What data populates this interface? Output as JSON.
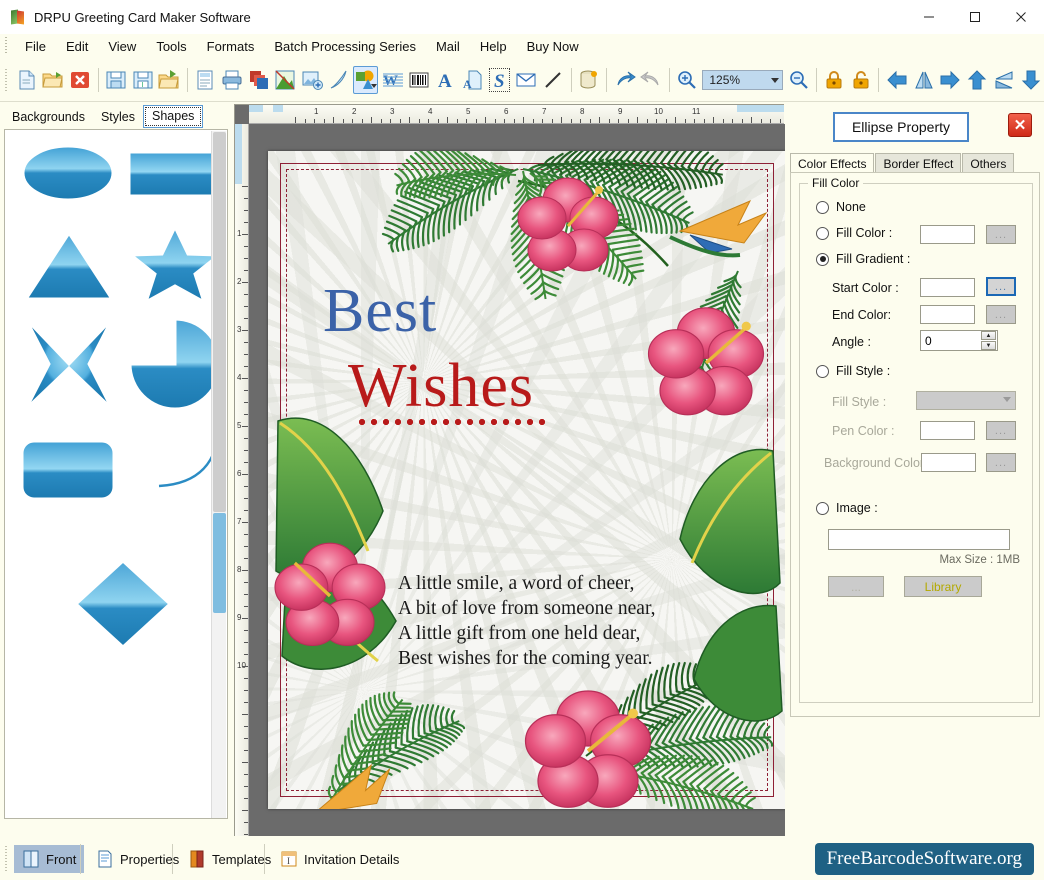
{
  "window": {
    "title": "DRPU Greeting Card Maker Software",
    "minimize": "–",
    "maximize": "☐",
    "close": "✕"
  },
  "menu": {
    "items": [
      {
        "label": "File"
      },
      {
        "label": "Edit"
      },
      {
        "label": "View"
      },
      {
        "label": "Tools"
      },
      {
        "label": "Formats"
      },
      {
        "label": "Batch Processing Series"
      },
      {
        "label": "Mail"
      },
      {
        "label": "Help"
      },
      {
        "label": "Buy Now"
      }
    ]
  },
  "toolbar": {
    "zoom_value": "125%",
    "icons": [
      "new-document-icon",
      "open-folder-icon",
      "close-document-icon",
      "save-icon",
      "save-as-icon",
      "export-folder-icon",
      "page-setup-icon",
      "print-icon",
      "copy-layers-icon",
      "clipart-icon",
      "insert-image-icon",
      "pen-tool-icon",
      "shapes-tool-icon",
      "watermark-icon",
      "barcode-icon",
      "text-icon",
      "text-on-page-icon",
      "signature-icon",
      "envelope-icon",
      "line-tool-icon",
      "database-icon",
      "undo-icon",
      "redo-icon",
      "zoom-in-icon",
      "zoom-out-icon",
      "lock-icon",
      "unlock-icon",
      "align-left-icon",
      "flip-horizontal-icon",
      "align-right-icon",
      "align-top-icon",
      "flip-vertical-icon",
      "align-bottom-icon"
    ]
  },
  "left_panel": {
    "tabs": [
      {
        "label": "Backgrounds",
        "active": false
      },
      {
        "label": "Styles",
        "active": false
      },
      {
        "label": "Shapes",
        "active": true
      }
    ],
    "shapes": [
      "ellipse-shape",
      "rectangle-shape",
      "triangle-shape",
      "star-shape",
      "four-point-star-shape",
      "pie-shape",
      "rounded-rectangle-shape",
      "arc-shape",
      "diamond-shape"
    ]
  },
  "canvas": {
    "ruler_h_labels": [
      "1",
      "2",
      "3",
      "4",
      "5",
      "6",
      "7",
      "8",
      "9",
      "10",
      "11"
    ],
    "ruler_v_labels": [
      "1",
      "2",
      "3",
      "4",
      "5",
      "6",
      "7",
      "8",
      "9",
      "10"
    ],
    "card": {
      "title_line1": "Best",
      "title_line2": "Wishes",
      "verse": "A little smile, a word of cheer,\nA bit of love from someone near,\nA little gift from one held dear,\nBest wishes for the coming year."
    }
  },
  "properties": {
    "title": "Ellipse Property",
    "close_label": "✕",
    "tabs": [
      {
        "label": "Color Effects",
        "active": true
      },
      {
        "label": "Border Effect",
        "active": false
      },
      {
        "label": "Others",
        "active": false
      }
    ],
    "group_label": "Fill Color",
    "options": {
      "none": "None",
      "fill_color": "Fill Color :",
      "fill_gradient": "Fill Gradient :",
      "fill_style": "Fill Style :",
      "image": "Image :"
    },
    "selected_option": "fill_gradient",
    "fields": {
      "start_color_label": "Start Color :",
      "end_color_label": "End Color:",
      "angle_label": "Angle :",
      "angle_value": "0",
      "fill_style_label": "Fill Style :",
      "pen_color_label": "Pen Color :",
      "background_color_label": "Background Color :",
      "browse_label": "...",
      "image_path": "",
      "max_size": "Max Size : 1MB",
      "image_browse_label": "...",
      "library_label": "Library"
    }
  },
  "bottom_bar": {
    "items": [
      {
        "label": "Front",
        "icon": "front-card-icon",
        "active": true
      },
      {
        "label": "Properties",
        "icon": "properties-icon",
        "active": false
      },
      {
        "label": "Templates",
        "icon": "templates-icon",
        "active": false
      },
      {
        "label": "Invitation Details",
        "icon": "invitation-details-icon",
        "active": false
      }
    ],
    "brand": "FreeBarcodeSoftware.org"
  },
  "colors": {
    "accent_blue": "#1b68b5",
    "panel_bg": "#fdfdee",
    "brand_bg": "#1f6184",
    "card_blue": "#3b62a8",
    "card_red": "#b81a1a",
    "frame_maroon": "#8e1f35"
  }
}
